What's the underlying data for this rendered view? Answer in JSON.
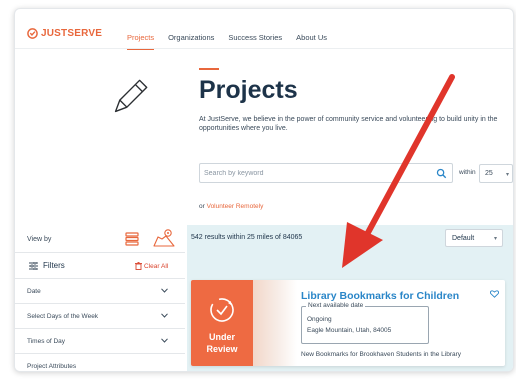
{
  "header": {
    "logo": "JUSTSERVE",
    "nav": [
      "Projects",
      "Organizations",
      "Success Stories",
      "About Us"
    ],
    "active_nav": "Projects"
  },
  "hero": {
    "title": "Projects",
    "intro": "At JustServe, we believe in the power of community service and volunteering to build unity in the opportunities where you live."
  },
  "search": {
    "placeholder": "Search by keyword",
    "within_label": "within",
    "within_value": "25"
  },
  "remote": {
    "prefix": "or",
    "link": "Volunteer Remotely"
  },
  "sidebar": {
    "view_by": "View by",
    "filters": "Filters",
    "clear_all": "Clear All",
    "items": [
      "Date",
      "Select Days of the Week",
      "Times of Day",
      "Project Attributes"
    ]
  },
  "results": {
    "count_text": "542 results within 25 miles of 84065",
    "sort_value": "Default"
  },
  "card": {
    "status_line1": "Under",
    "status_line2": "Review",
    "title": "Library Bookmarks for Children",
    "date_legend": "Next available date",
    "date_value": "Ongoing",
    "location": "Eagle Mountain, Utah, 84005",
    "description": "New Bookmarks for Brookhaven Students in the Library"
  },
  "colors": {
    "brand_orange": "#e8673c",
    "card_thumb": "#ee6a42",
    "link_blue": "#2a86c8",
    "navy": "#1d3349",
    "results_bg": "#e3f1f4",
    "arrow_red": "#e0352b"
  },
  "icons": [
    "logo-icon",
    "pencil-icon",
    "search-icon",
    "list-view-icon",
    "map-view-icon",
    "filters-icon",
    "trash-icon",
    "chevron-down-icon",
    "review-icon",
    "heart-icon"
  ]
}
